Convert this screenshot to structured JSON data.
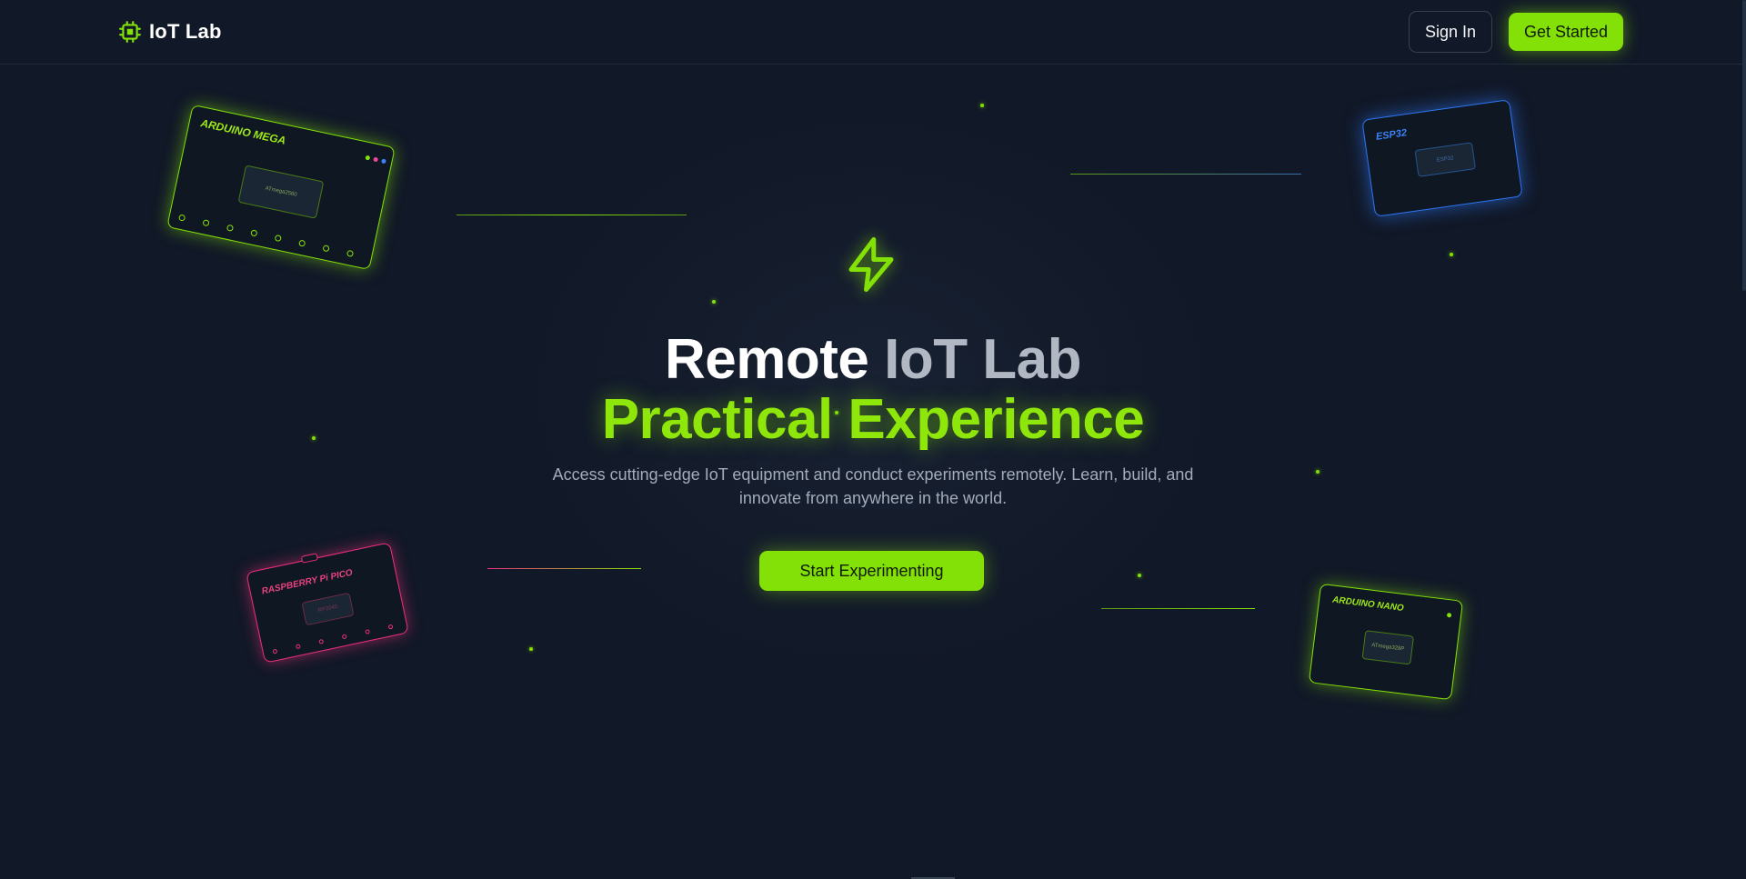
{
  "header": {
    "logo_text": "IoT Lab",
    "logo_icon": "chip-icon",
    "sign_in_label": "Sign In",
    "get_started_label": "Get Started"
  },
  "hero": {
    "icon": "lightning-bolt-icon",
    "title_line1_part1": "Remote",
    "title_line1_part2": "IoT Lab",
    "title_line2": "Practical Experience",
    "subtitle": "Access cutting-edge IoT equipment and conduct experiments remotely. Learn, build, and innovate from anywhere in the world.",
    "cta_label": "Start Experimenting"
  },
  "boards": {
    "arduino_mega": {
      "label": "ARDUINO MEGA",
      "chip": "ATmega2560"
    },
    "esp32": {
      "label": "ESP32",
      "chip": "ESP32"
    },
    "pico": {
      "label": "RASPBERRY Pi PICO",
      "chip": "RP2040"
    },
    "arduino_nano": {
      "label": "ARDUINO NANO",
      "chip": "ATmega328P"
    }
  },
  "colors": {
    "background": "#111827",
    "accent": "#84e108",
    "esp32": "#3b82f6",
    "pico": "#ec4899"
  }
}
